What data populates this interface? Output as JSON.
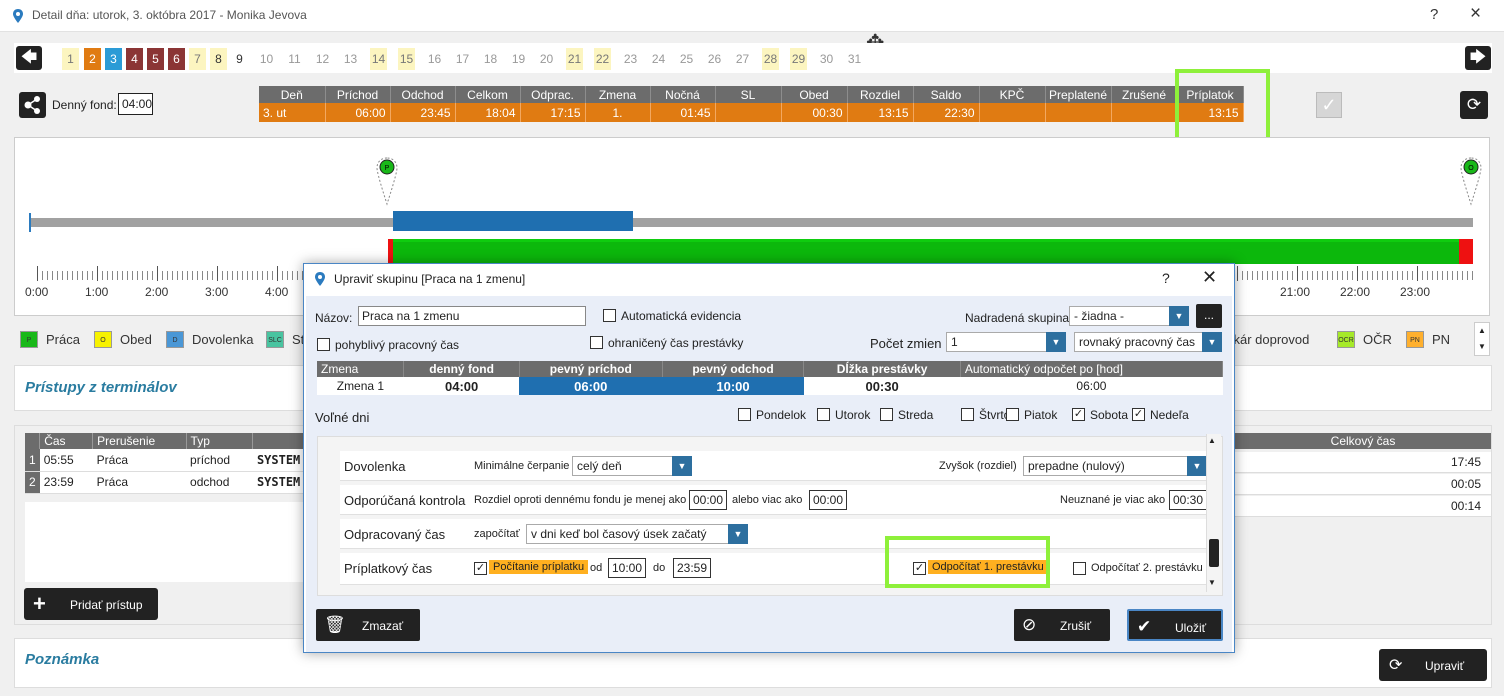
{
  "window": {
    "title": "Detail dňa: utorok, 3. októbra 2017 -  Monika Jevova",
    "help": "?",
    "close": "×",
    "move_icon": "✥"
  },
  "days": {
    "prev": "🡄",
    "next": "🡆",
    "items": [
      {
        "n": "1",
        "s": "y"
      },
      {
        "n": "2",
        "s": "o"
      },
      {
        "n": "3",
        "s": "b"
      },
      {
        "n": "4",
        "s": "r"
      },
      {
        "n": "5",
        "s": "r"
      },
      {
        "n": "6",
        "s": "r"
      },
      {
        "n": "7",
        "s": "y"
      },
      {
        "n": "8",
        "s": "yk"
      },
      {
        "n": "9",
        "s": "k"
      },
      {
        "n": "10",
        "s": ""
      },
      {
        "n": "11",
        "s": ""
      },
      {
        "n": "12",
        "s": ""
      },
      {
        "n": "13",
        "s": ""
      },
      {
        "n": "14",
        "s": "y"
      },
      {
        "n": "15",
        "s": "y"
      },
      {
        "n": "16",
        "s": ""
      },
      {
        "n": "17",
        "s": ""
      },
      {
        "n": "18",
        "s": ""
      },
      {
        "n": "19",
        "s": ""
      },
      {
        "n": "20",
        "s": ""
      },
      {
        "n": "21",
        "s": "y"
      },
      {
        "n": "22",
        "s": "y"
      },
      {
        "n": "23",
        "s": ""
      },
      {
        "n": "24",
        "s": ""
      },
      {
        "n": "25",
        "s": ""
      },
      {
        "n": "26",
        "s": ""
      },
      {
        "n": "27",
        "s": ""
      },
      {
        "n": "28",
        "s": "y"
      },
      {
        "n": "29",
        "s": "y"
      },
      {
        "n": "30",
        "s": ""
      },
      {
        "n": "31",
        "s": ""
      }
    ]
  },
  "fund": {
    "label": "Denný fond:",
    "value": "04:00"
  },
  "summary": {
    "headers": [
      "Deň",
      "Príchod",
      "Odchod",
      "Celkom",
      "Odprac.",
      "Zmena",
      "Nočná",
      "SL",
      "Obed",
      "Rozdiel",
      "Saldo",
      "KPČ",
      "Preplatené",
      "Zrušené",
      "Príplatok"
    ],
    "row": [
      "3. ut",
      "06:00",
      "23:45",
      "18:04",
      "17:15",
      "1.",
      "01:45",
      "",
      "00:30",
      "13:15",
      "22:30",
      "",
      "",
      "",
      "13:15"
    ]
  },
  "confirm_icon": "✓",
  "refresh_icon": "⟳",
  "timeline": {
    "ticks": [
      "0:00",
      "1:00",
      "2:00",
      "3:00",
      "4:00",
      "21:00",
      "22:00",
      "23:00"
    ],
    "pin_start": "P",
    "pin_end": "O"
  },
  "legend": [
    {
      "code": "P",
      "label": "Práca",
      "color": "#19b819"
    },
    {
      "code": "O",
      "label": "Obed",
      "color": "#f7f200"
    },
    {
      "code": "D",
      "label": "Dovolenka",
      "color": "#4a97d6"
    },
    {
      "code": "SLC",
      "label": "St",
      "color": "#49c4a0"
    },
    {
      "code": "",
      "label": "Lekár doprovod",
      "color": ""
    },
    {
      "code": "OCR",
      "label": "OČR",
      "color": "#a6ea29"
    },
    {
      "code": "PN",
      "label": "PN",
      "color": "#ffb02e"
    }
  ],
  "access": {
    "title": "Prístupy z terminálov",
    "headers": [
      "Čas",
      "Prerušenie",
      "Typ"
    ],
    "rows": [
      {
        "n": "1",
        "time": "05:55",
        "pr": "Práca",
        "typ": "príchod",
        "src": "SYSTEM"
      },
      {
        "n": "2",
        "time": "23:59",
        "pr": "Práca",
        "typ": "odchod",
        "src": "SYSTEM"
      }
    ],
    "total_header": "Celkový čas",
    "totals": [
      "17:45",
      "00:05",
      "00:14"
    ],
    "add_button": "Pridať prístup"
  },
  "note": {
    "title": "Poznámka",
    "edit_button": "Upraviť"
  },
  "dialog": {
    "title": "Upraviť skupinu [Praca na 1 zmenu]",
    "help": "?",
    "close": "✕",
    "name_label": "Názov:",
    "name_value": "Praca na 1 zmenu",
    "auto_evidence": "Automatická evidencia",
    "parent_label": "Nadradená skupina:",
    "parent_value": "- žiadna -",
    "more": "...",
    "flex": "pohyblivý pracovný čas",
    "limited": "ohraničený čas prestávky",
    "shifts_label": "Počet zmien",
    "shifts_value": "1",
    "shift_type": "rovnaký pracovný čas",
    "shift_table": {
      "headers": [
        "Zmena",
        "denný fond",
        "pevný príchod",
        "pevný odchod",
        "Dĺžka prestávky",
        "Automatický odpočet po [hod]"
      ],
      "row": [
        "Zmena 1",
        "04:00",
        "06:00",
        "10:00",
        "00:30",
        "06:00"
      ]
    },
    "free_days_label": "Voľné dni",
    "weekdays": [
      {
        "label": "Pondelok",
        "checked": false
      },
      {
        "label": "Utorok",
        "checked": false
      },
      {
        "label": "Streda",
        "checked": false
      },
      {
        "label": "Štvrtok",
        "checked": false
      },
      {
        "label": "Piatok",
        "checked": false
      },
      {
        "label": "Sobota",
        "checked": true
      },
      {
        "label": "Nedeľa",
        "checked": true
      }
    ],
    "vacation": {
      "label": "Dovolenka",
      "min_label": "Minimálne čerpanie",
      "min_value": "celý deň",
      "incr_label": "Zvyšok (rozdiel)",
      "incr_value": "prepadne (nulový)"
    },
    "recommended": {
      "label": "Odporúčaná kontrola",
      "diff_label": "Rozdiel oproti dennému fondu je menej ako",
      "a": "00:00",
      "or_label": "alebo viac ako",
      "b": "00:00",
      "unrec_label": "Neuznané je viac ako",
      "c": "00:30"
    },
    "worked": {
      "label": "Odpracovaný čas",
      "count_label": "započítať",
      "value": "v dni keď bol časový úsek  začatý"
    },
    "bonus": {
      "label": "Príplatkový čas",
      "calc_label": "Počítanie príplatku",
      "from_label": "od",
      "from": "10:00",
      "to_label": "do",
      "to": "23:59",
      "sub1": "Odpočítať 1. prestávku",
      "sub2": "Odpočítať 2. prestávku"
    },
    "delete_button": "Zmazať",
    "cancel_button": "Zrušiť",
    "save_button": "Uložiť"
  }
}
